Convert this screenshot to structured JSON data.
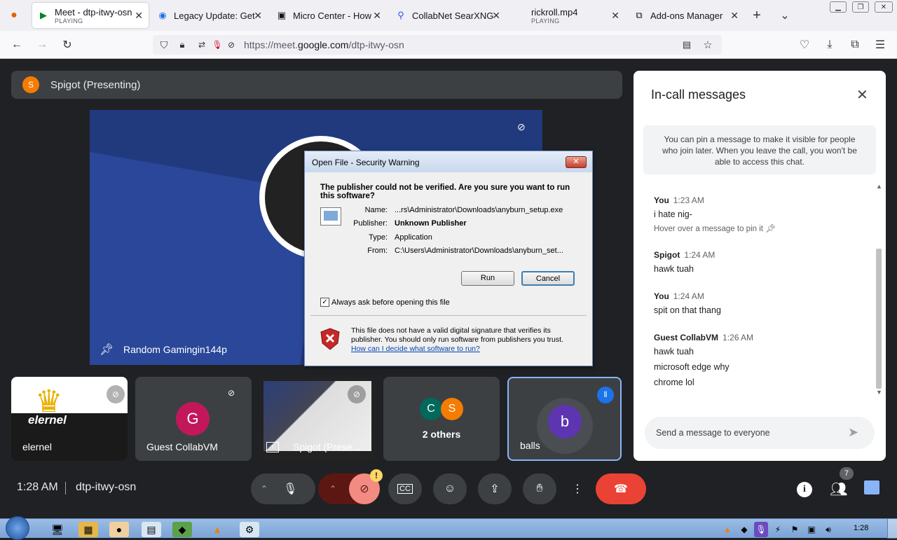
{
  "browser": {
    "tabs": [
      {
        "label": "Meet - dtp-itwy-osn",
        "sub": "PLAYING"
      },
      {
        "label": "Legacy Update: Get I",
        "sub": ""
      },
      {
        "label": "Micro Center - How",
        "sub": ""
      },
      {
        "label": "CollabNet SearXNG",
        "sub": ""
      },
      {
        "label": "rickroll.mp4",
        "sub": "PLAYING"
      },
      {
        "label": "Add-ons Manager",
        "sub": ""
      }
    ],
    "url_prefix": "https://meet.",
    "url_domain": "google.com",
    "url_path": "/dtp-itwy-osn"
  },
  "meet": {
    "presenter_initial": "S",
    "presenter_label": "Spigot (Presenting)",
    "stage_name": "Random Gamingin144p",
    "tiles": [
      {
        "name": "elernel",
        "overlay": "elernel"
      },
      {
        "name": "Guest CollabVM",
        "initial": "G"
      },
      {
        "name": "Spigot (Prese..."
      },
      {
        "name": "2 others",
        "initials": [
          "C",
          "S"
        ]
      },
      {
        "name": "balls",
        "initial": "b"
      }
    ],
    "time": "1:28 AM",
    "code": "dtp-itwy-osn",
    "people_count": "7",
    "alert_badge": "!"
  },
  "dialog": {
    "title": "Open File - Security Warning",
    "heading": "The publisher could not be verified.  Are you sure you want to run this software?",
    "name_label": "Name:",
    "name_value": "...rs\\Administrator\\Downloads\\anyburn_setup.exe",
    "publisher_label": "Publisher:",
    "publisher_value": "Unknown Publisher",
    "type_label": "Type:",
    "type_value": "Application",
    "from_label": "From:",
    "from_value": "C:\\Users\\Administrator\\Downloads\\anyburn_set...",
    "run": "Run",
    "cancel": "Cancel",
    "checkbox_label": "Always ask before opening this file",
    "warning": "This file does not have a valid digital signature that verifies its publisher.  You should only run software from publishers you trust.",
    "link": "How can I decide what software to run?"
  },
  "chat": {
    "title": "In-call messages",
    "info": "You can pin a message to make it visible for people who join later. When you leave the call, you won't be able to access this chat.",
    "messages": [
      {
        "sender": "You",
        "time": "1:23 AM",
        "lines": [
          "i hate nig-"
        ],
        "hint": "Hover over a message to pin it"
      },
      {
        "sender": "Spigot",
        "time": "1:24 AM",
        "lines": [
          "hawk tuah"
        ]
      },
      {
        "sender": "You",
        "time": "1:24 AM",
        "lines": [
          "spit on that thang"
        ]
      },
      {
        "sender": "Guest CollabVM",
        "time": "1:26 AM",
        "lines": [
          "hawk tuah",
          "microsoft edge why",
          "chrome lol"
        ]
      }
    ],
    "input_placeholder": "Send a message to everyone"
  },
  "taskbar": {
    "clock": "1:28"
  },
  "colors": {
    "meet_bg": "#202124",
    "end_call": "#ea4335",
    "accent_blue": "#8ab4f8",
    "presenter_orange": "#f57c00"
  }
}
